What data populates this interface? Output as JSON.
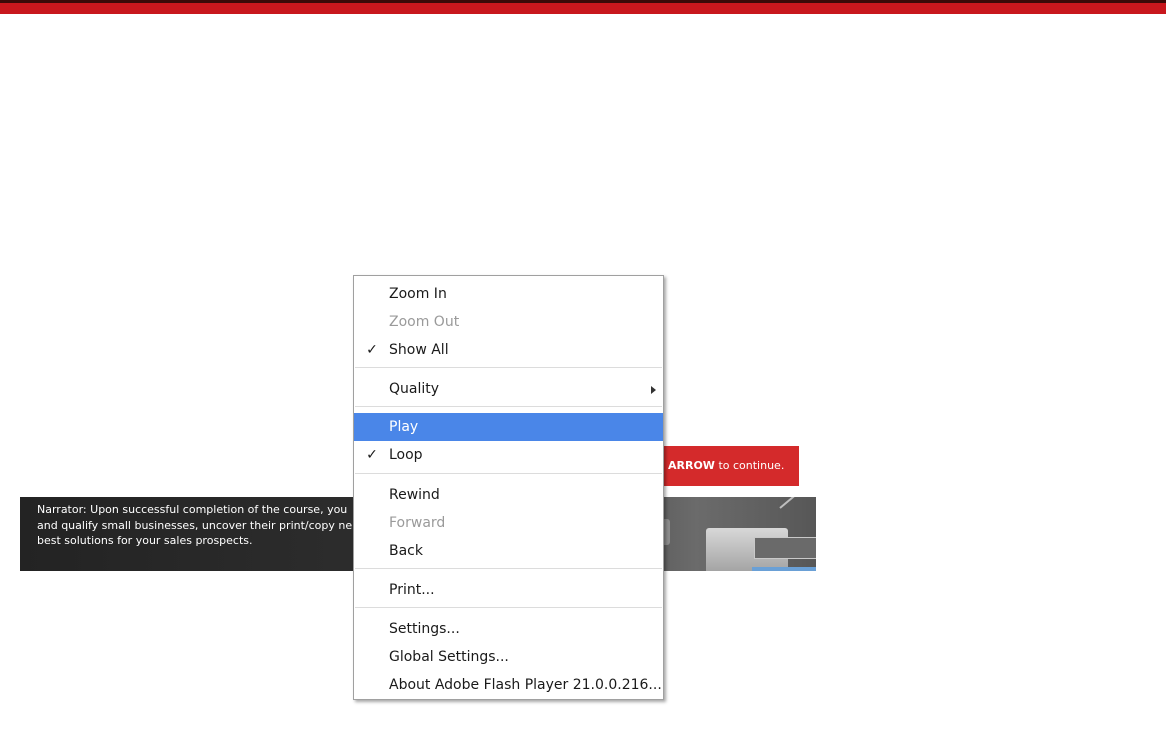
{
  "banner": {
    "prefix": "",
    "bold_text": "ARROW",
    "suffix": " to continue."
  },
  "narrator": {
    "text": "Narrator:  Upon successful completion of the course, you\nand qualify small businesses, uncover their print/copy ne\nbest solutions for your sales prospects."
  },
  "context_menu": {
    "zoom_in": "Zoom In",
    "zoom_out": "Zoom Out",
    "show_all": "Show All",
    "quality": "Quality",
    "play": "Play",
    "loop": "Loop",
    "rewind": "Rewind",
    "forward": "Forward",
    "back": "Back",
    "print": "Print...",
    "settings": "Settings...",
    "global_settings": "Global Settings...",
    "about": "About Adobe Flash Player 21.0.0.216...",
    "check_glyph": "✓",
    "highlighted_item": "Play",
    "disabled_items": [
      "Zoom Out",
      "Forward"
    ],
    "checked_items": [
      "Show All",
      "Loop"
    ]
  },
  "colors": {
    "top_bar": "#c8171d",
    "banner": "#d42a2b",
    "highlight": "#4a86e8"
  }
}
